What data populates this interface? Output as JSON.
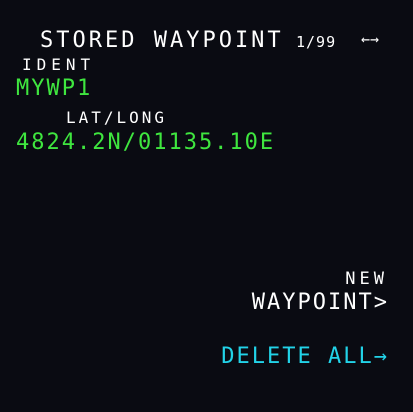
{
  "header": {
    "title": "STORED WAYPOINT",
    "page_indicator": "1/99",
    "arrows": "←→"
  },
  "fields": {
    "ident_label": "IDENT",
    "ident_value": "MYWP1",
    "latlong_label": "LAT/LONG",
    "latlong_value": "4824.2N/01135.10E"
  },
  "actions": {
    "new_label": "NEW",
    "new_waypoint": "WAYPOINT>",
    "delete_all": "DELETE ALL→"
  },
  "colors": {
    "background": "#0a0b12",
    "label": "#ffffff",
    "data": "#3fe63f",
    "action": "#22d3e8"
  }
}
